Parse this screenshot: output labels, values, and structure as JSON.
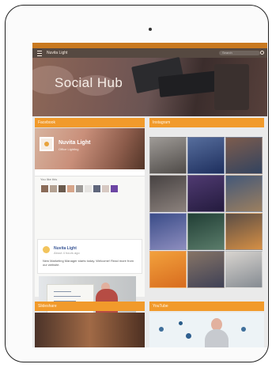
{
  "app": {
    "brand": "Nuvita Light",
    "search_placeholder": "Search"
  },
  "hero": {
    "title": "Social Hub"
  },
  "sections": {
    "facebook": "Facebook",
    "instagram": "Instagram",
    "slideshare": "Slideshare",
    "youtube": "YouTube"
  },
  "facebook": {
    "page_name": "Nuvita Light",
    "page_subtitle": "Office Lighting",
    "friends_label": "You like this",
    "post": {
      "title": "Nuvita Light",
      "time": "About 4 hours ago",
      "text": "New Marketing Manager starts today. Welcome! Read more from our website."
    }
  },
  "colors": {
    "accent_orange": "#f19a2b",
    "top_bar": "#c9791f",
    "facebook_link": "#3a5796"
  },
  "icons": {
    "menu": "hamburger-icon",
    "search": "search-icon"
  }
}
